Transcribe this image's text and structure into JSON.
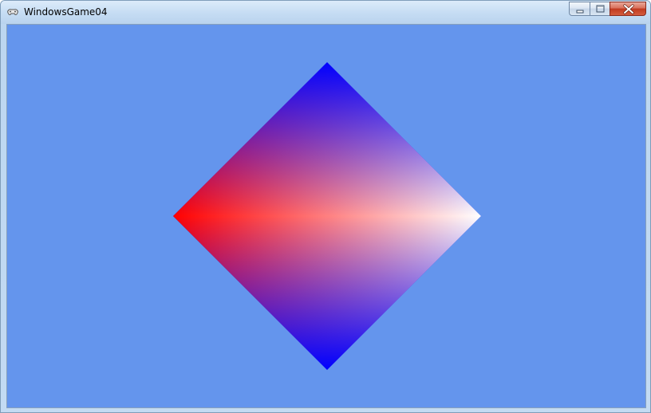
{
  "window": {
    "title": "WindowsGame04",
    "app_icon": "gamepad-icon",
    "caption_buttons": [
      "minimize-icon",
      "maximize-icon",
      "close-icon"
    ]
  },
  "scene": {
    "background_color": "#6495ed",
    "shape": "diamond",
    "vertex_colors": {
      "top": "#0000ff",
      "left": "#ff0000",
      "right": "#ffffff",
      "bottom": "#0000ff"
    }
  }
}
